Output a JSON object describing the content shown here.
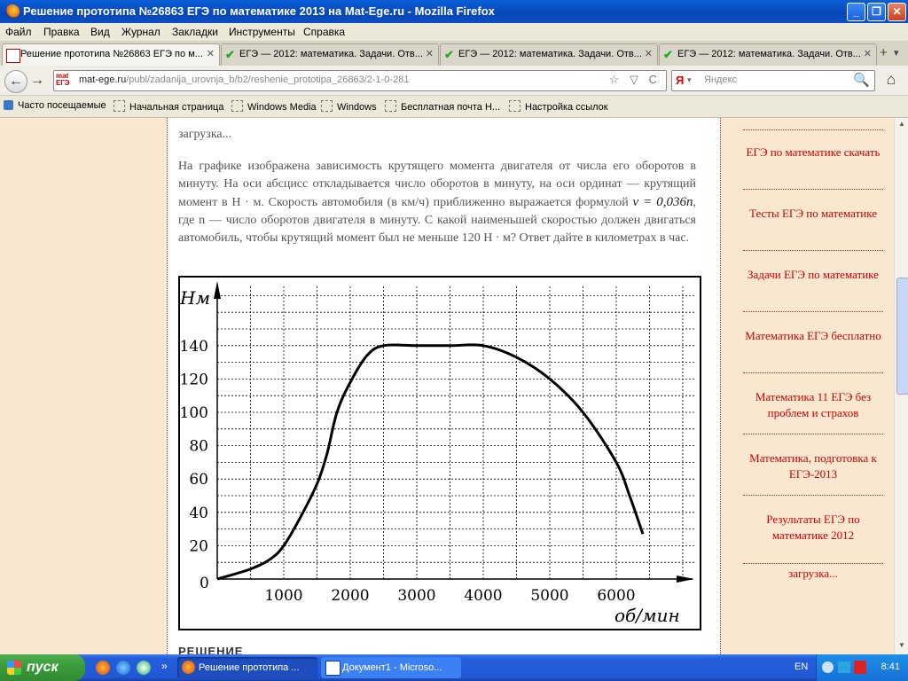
{
  "window": {
    "title": "Решение прототипа №26863 ЕГЭ по математике 2013 на Mat-Ege.ru - Mozilla Firefox",
    "min": "_",
    "max": "❐",
    "close": "✕"
  },
  "menu": [
    "Файл",
    "Правка",
    "Вид",
    "Журнал",
    "Закладки",
    "Инструменты",
    "Справка"
  ],
  "tabs": [
    {
      "label": "Решение прототипа №26863 ЕГЭ по м...",
      "close": "✕"
    },
    {
      "label": "ЕГЭ — 2012: математика. Задачи. Отв...",
      "close": "✕"
    },
    {
      "label": "ЕГЭ — 2012: математика. Задачи. Отв...",
      "close": "✕"
    },
    {
      "label": "ЕГЭ — 2012: математика. Задачи. Отв...",
      "close": "✕"
    }
  ],
  "tabstrip": {
    "new_tab": "+",
    "list": "▾"
  },
  "nav": {
    "site_icon_text": "mat\nЕГЭ",
    "url_domain": "mat-ege.ru",
    "url_path": "/publ/zadanija_urovnja_b/b2/reshenie_prototipa_26863/2-1-0-281",
    "url_icons": "☆ ▽ C",
    "search_engine": "Я",
    "search_placeholder": "Яндекс",
    "back": "←",
    "forward": "→",
    "home": "⌂",
    "search_glyph": "🔍"
  },
  "bookmarks": [
    "Часто посещаемые",
    "Начальная страница",
    "Windows Media",
    "Windows",
    "Бесплатная почта Н...",
    "Настройка ссылок"
  ],
  "article": {
    "loading": "загрузка...",
    "problem_part1": "На графике изображена зависимость крутящего момента двигателя от числа его оборотов в минуту. На оси абсцисс откладывается число оборотов в минуту, на оси ординат — крутящий момент в Н · м. Скорость автомобиля (в км/ч) приближенно выражается формулой ",
    "formula": "v = 0,036n",
    "problem_part2": ", где n — число оборотов двигателя в минуту. С какой наименьшей скоростью должен двигаться автомобиль, чтобы крутящий момент был не меньше 120 Н · м? Ответ дайте в километрах в час.",
    "next_heading": "РЕШЕНИЕ"
  },
  "chart_data": {
    "type": "line",
    "ylabel": "Нм",
    "xlabel": "об/мин",
    "origin_label": "0",
    "x_ticks": [
      1000,
      2000,
      3000,
      4000,
      5000,
      6000
    ],
    "y_ticks": [
      20,
      40,
      60,
      80,
      100,
      120,
      140
    ],
    "xlim": [
      0,
      7000
    ],
    "ylim": [
      0,
      160
    ],
    "grid": true,
    "series": [
      {
        "x": [
          0,
          500,
          800,
          1000,
          1250,
          1500,
          1650,
          1800,
          2000,
          2250,
          2500,
          3000,
          3500,
          4000,
          4500,
          5000,
          5500,
          6000,
          6200,
          6400
        ],
        "y": [
          0,
          6,
          12,
          20,
          37,
          57,
          75,
          100,
          118,
          134,
          140,
          140,
          140,
          140,
          133,
          120,
          100,
          70,
          50,
          27
        ]
      }
    ]
  },
  "sidebar": {
    "top_loading": "",
    "links": [
      "ЕГЭ по математике скачать",
      "Тесты ЕГЭ по математике",
      "Задачи ЕГЭ по математике",
      "Математика ЕГЭ бесплатно",
      "Математика 11 ЕГЭ без проблем и страхов",
      "Математика, подготовка к ЕГЭ-2013",
      "Результаты ЕГЭ по математике 2012"
    ],
    "bottom_loading": "загрузка..."
  },
  "taskbar": {
    "start": "пуск",
    "tasks": [
      "Решение прототипа ...",
      "Документ1 - Microso..."
    ],
    "lang": "EN",
    "clock": "8:41",
    "more": "»"
  }
}
